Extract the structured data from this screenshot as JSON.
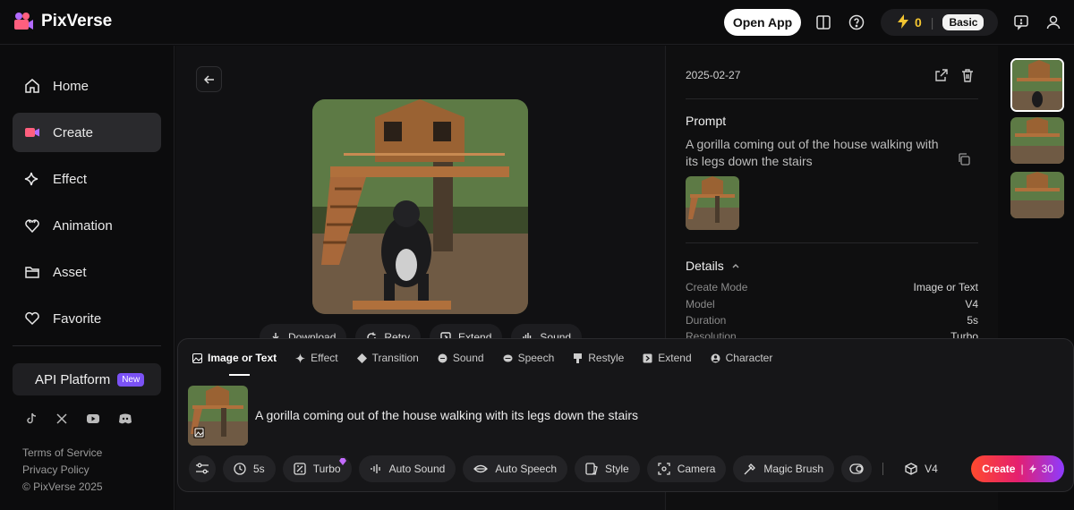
{
  "brand": {
    "name": "PixVerse"
  },
  "topbar": {
    "open_app": "Open App",
    "credits": "0",
    "plan": "Basic"
  },
  "sidebar": {
    "items": [
      {
        "label": "Home",
        "icon": "home-icon"
      },
      {
        "label": "Create",
        "icon": "create-icon"
      },
      {
        "label": "Effect",
        "icon": "sparkle-icon"
      },
      {
        "label": "Animation",
        "icon": "heart-hands-icon"
      },
      {
        "label": "Asset",
        "icon": "folder-icon"
      },
      {
        "label": "Favorite",
        "icon": "heart-icon"
      }
    ],
    "api_label": "API Platform",
    "api_badge": "New",
    "footer": {
      "terms": "Terms of Service",
      "privacy": "Privacy Policy",
      "copyright": "© PixVerse 2025"
    }
  },
  "main": {
    "actions": [
      {
        "label": "Download",
        "icon": "download-icon"
      },
      {
        "label": "Retry",
        "icon": "retry-icon"
      },
      {
        "label": "Extend",
        "icon": "extend-icon"
      },
      {
        "label": "Sound",
        "icon": "sound-icon"
      }
    ]
  },
  "details": {
    "date": "2025-02-27",
    "prompt_heading": "Prompt",
    "prompt": "A gorilla coming out of the house walking with its legs down the stairs",
    "details_heading": "Details",
    "rows": [
      {
        "key": "Create Mode",
        "value": "Image or Text"
      },
      {
        "key": "Model",
        "value": "V4"
      },
      {
        "key": "Duration",
        "value": "5s"
      },
      {
        "key": "Resolution",
        "value": "Turbo"
      }
    ]
  },
  "composer": {
    "tabs": [
      "Image or Text",
      "Effect",
      "Transition",
      "Sound",
      "Speech",
      "Restyle",
      "Extend",
      "Character"
    ],
    "prompt": "A gorilla coming out of the house walking with its legs down the stairs",
    "tools": {
      "duration": "5s",
      "quality": "Turbo",
      "auto_sound": "Auto Sound",
      "auto_speech": "Auto Speech",
      "style": "Style",
      "camera": "Camera",
      "magic_brush": "Magic Brush",
      "model": "V4"
    },
    "create_label": "Create",
    "create_cost": "30"
  },
  "colors": {
    "accent_start": "#ff4a2d",
    "accent_end": "#8d3bff",
    "credit": "#f3c531"
  }
}
